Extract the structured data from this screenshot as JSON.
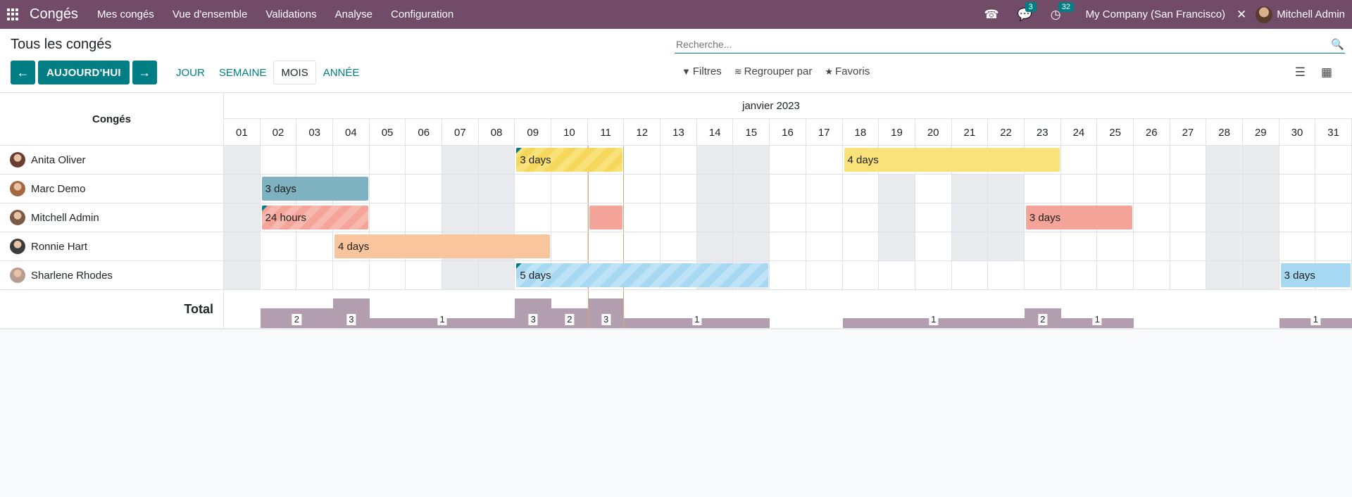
{
  "navbar": {
    "app_name": "Congés",
    "menu": [
      "Mes congés",
      "Vue d'ensemble",
      "Validations",
      "Analyse",
      "Configuration"
    ],
    "messages_badge": "3",
    "activities_badge": "32",
    "company": "My Company (San Francisco)",
    "user": "Mitchell Admin",
    "icons": [
      "apps-icon",
      "phone-icon",
      "chat-icon",
      "clock-icon",
      "tools-icon"
    ]
  },
  "control_panel": {
    "title": "Tous les congés",
    "search_placeholder": "Recherche...",
    "today_label": "AUJOURD'HUI",
    "scales": [
      "JOUR",
      "SEMAINE",
      "MOIS",
      "ANNÉE"
    ],
    "active_scale": "MOIS",
    "filters_label": "Filtres",
    "groupby_label": "Regrouper par",
    "favorites_label": "Favoris"
  },
  "gantt": {
    "title": "Congés",
    "month": "janvier 2023",
    "days": [
      "01",
      "02",
      "03",
      "04",
      "05",
      "06",
      "07",
      "08",
      "09",
      "10",
      "11",
      "12",
      "13",
      "14",
      "15",
      "16",
      "17",
      "18",
      "19",
      "20",
      "21",
      "22",
      "23",
      "24",
      "25",
      "26",
      "27",
      "28",
      "29",
      "30",
      "31"
    ],
    "weekend_days": [
      1,
      7,
      8,
      14,
      15,
      21,
      22,
      28,
      29
    ],
    "today_day": 11,
    "total_label": "Total",
    "rows": [
      {
        "name": "Anita Oliver",
        "avatar_color": "#6b3d33",
        "weekend_days": [
          1,
          7,
          8,
          14,
          15,
          28,
          29
        ],
        "pills": [
          {
            "start": 9,
            "end": 11,
            "label": "3 days",
            "style": "striped-y",
            "tri": true
          },
          {
            "start": 18,
            "end": 23,
            "label": "4 days",
            "color": "#f9e27a",
            "tri": false
          }
        ]
      },
      {
        "name": "Marc Demo",
        "avatar_color": "#a5673f",
        "weekend_days": [
          1,
          7,
          8,
          14,
          15,
          19,
          21,
          22,
          28,
          29
        ],
        "pills": [
          {
            "start": 2,
            "end": 4,
            "label": "3 days",
            "color": "#7fb2c0",
            "tri": false
          }
        ]
      },
      {
        "name": "Mitchell Admin",
        "avatar_color": "#7d5a43",
        "weekend_days": [
          1,
          7,
          8,
          14,
          15,
          19,
          21,
          22,
          28,
          29
        ],
        "pills": [
          {
            "start": 2,
            "end": 4,
            "label": "24 hours",
            "style": "striped-r",
            "tri": true
          },
          {
            "start": 11,
            "end": 11,
            "label": "",
            "color": "#f5a49a",
            "tri": false
          },
          {
            "start": 23,
            "end": 25,
            "label": "3 days",
            "color": "#f5a49a",
            "tri": false
          }
        ]
      },
      {
        "name": "Ronnie Hart",
        "avatar_color": "#3c3c3c",
        "weekend_days": [
          1,
          7,
          8,
          14,
          15,
          19,
          21,
          22,
          28,
          29
        ],
        "pills": [
          {
            "start": 4,
            "end": 9,
            "label": "4 days",
            "color": "#f9c59d",
            "tri": false
          }
        ]
      },
      {
        "name": "Sharlene Rhodes",
        "avatar_color": "#b79c91",
        "weekend_days": [
          1,
          7,
          8,
          14,
          15,
          28,
          29
        ],
        "pills": [
          {
            "start": 9,
            "end": 15,
            "label": "5 days",
            "style": "striped-b",
            "tri": true
          },
          {
            "start": 30,
            "end": 31,
            "label": "3 days",
            "color": "#a6d8f1",
            "tri": false
          }
        ]
      }
    ],
    "totals": [
      {
        "start": 2,
        "end": 3,
        "value": 2
      },
      {
        "start": 4,
        "end": 4,
        "value": 3
      },
      {
        "start": 5,
        "end": 8,
        "value": 1
      },
      {
        "start": 9,
        "end": 9,
        "value": 3
      },
      {
        "start": 10,
        "end": 10,
        "value": 2
      },
      {
        "start": 11,
        "end": 11,
        "value": 3
      },
      {
        "start": 12,
        "end": 15,
        "value": 1
      },
      {
        "start": 18,
        "end": 22,
        "value": 1
      },
      {
        "start": 23,
        "end": 23,
        "value": 2
      },
      {
        "start": 24,
        "end": 25,
        "value": 1
      },
      {
        "start": 30,
        "end": 31,
        "value": 1
      }
    ]
  }
}
